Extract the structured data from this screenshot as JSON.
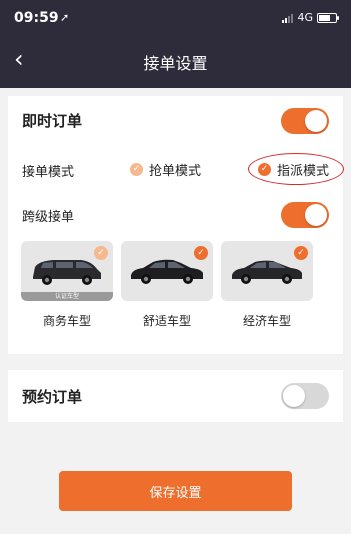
{
  "status_bar": {
    "time": "09:59",
    "network": "4G"
  },
  "header": {
    "title": "接单设置"
  },
  "instant_order": {
    "title": "即时订单",
    "enabled": true,
    "mode_label": "接单模式",
    "modes": [
      {
        "label": "抢单模式",
        "selected": false
      },
      {
        "label": "指派模式",
        "selected": true
      }
    ],
    "cross_level": {
      "label": "跨级接单",
      "enabled": true
    },
    "car_types": [
      {
        "label": "商务车型",
        "selected": false,
        "badge": "认证车型"
      },
      {
        "label": "舒适车型",
        "selected": true
      },
      {
        "label": "经济车型",
        "selected": true
      }
    ]
  },
  "reserve_order": {
    "title": "预约订单",
    "enabled": false
  },
  "save_button": {
    "label": "保存设置"
  },
  "colors": {
    "accent": "#ee6f2d",
    "header": "#2e2c3a",
    "annotation": "#d72a2a"
  }
}
